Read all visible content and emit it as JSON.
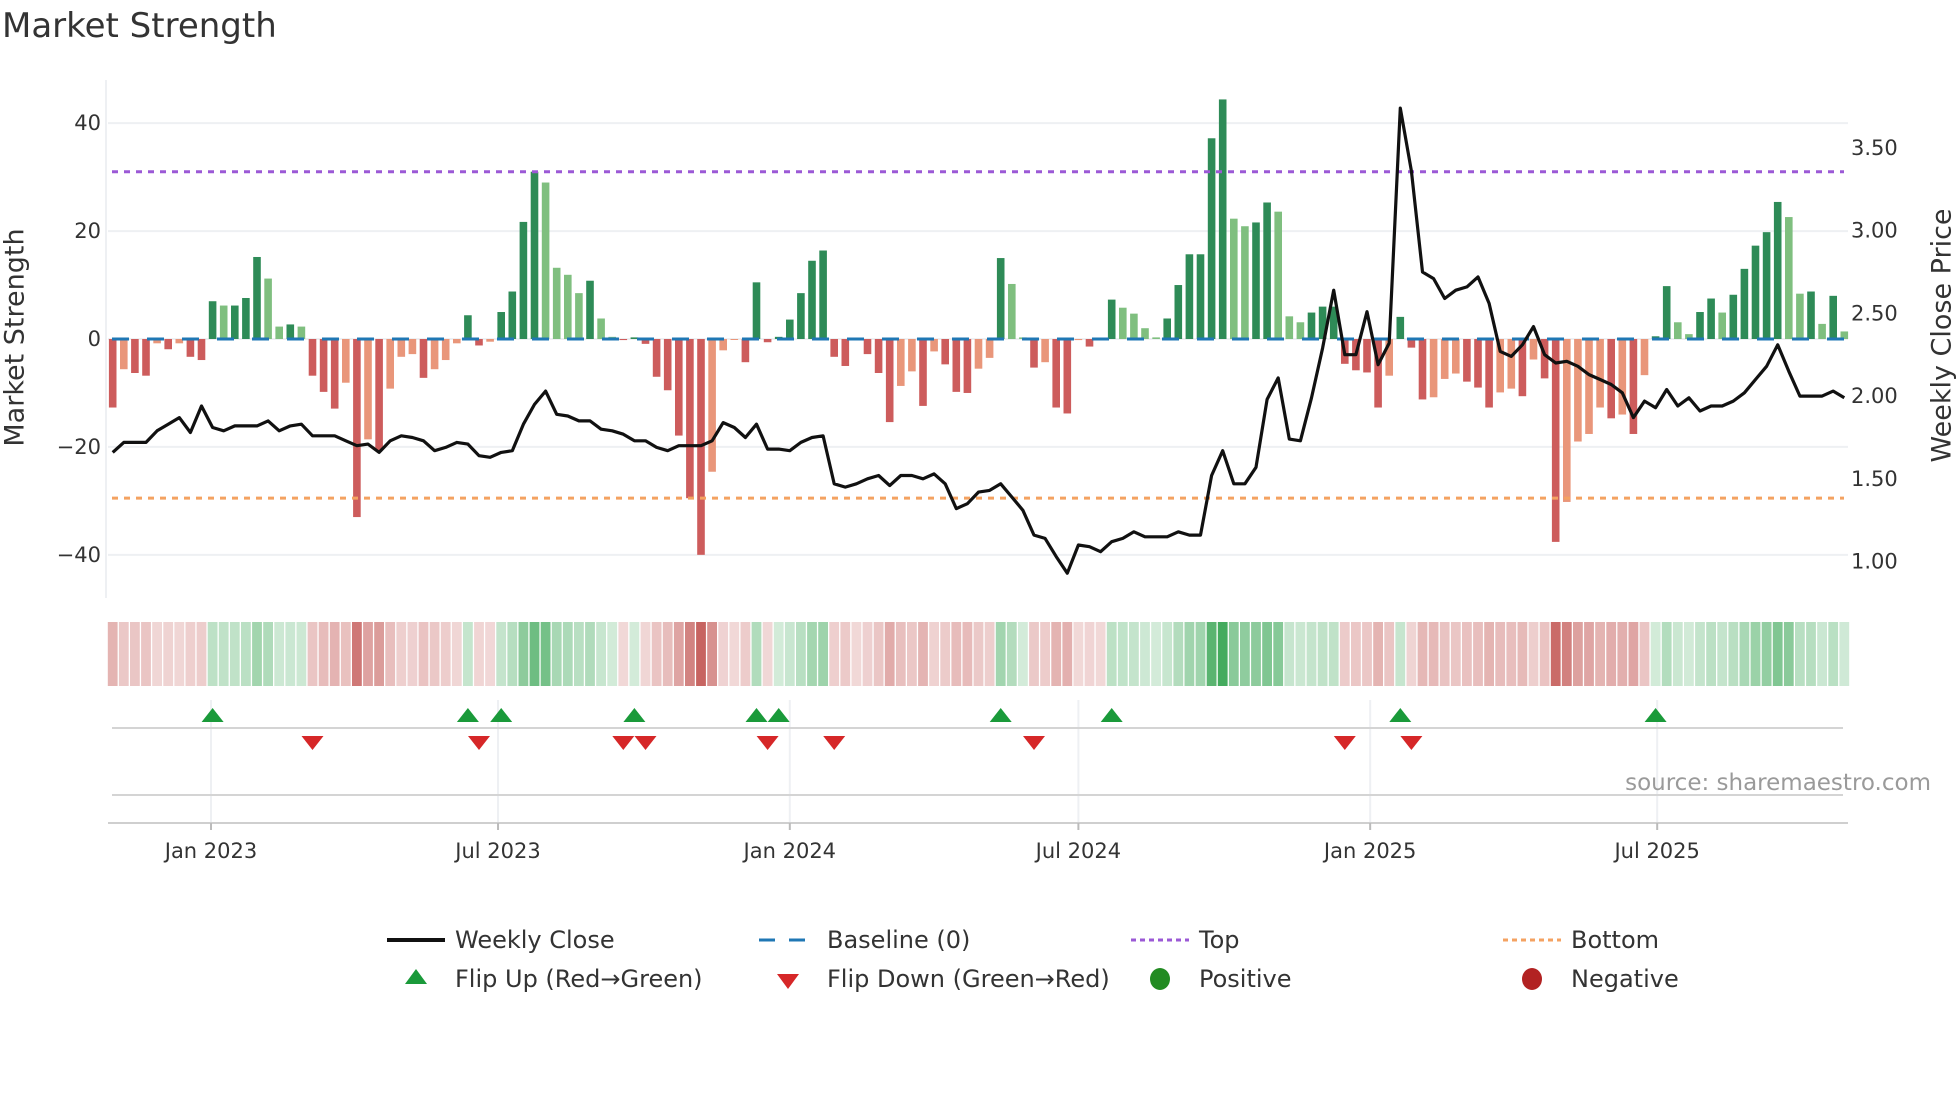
{
  "title": "Market Strength",
  "source": "source: sharemaestro.com",
  "colors": {
    "strong_green": "#2e8b57",
    "weak_green": "#7fbf7f",
    "strong_red": "#cd5c5c",
    "weak_red": "#e9967a",
    "baseline": "#1f77b4",
    "top": "#9b59d6",
    "bottom": "#f4a261",
    "price": "#111111",
    "flip_up": "#1a9a3a",
    "flip_down": "#d62728",
    "positive": "#228b22",
    "negative": "#b22222"
  },
  "legend": [
    {
      "key": "weekly_close",
      "label": "Weekly Close"
    },
    {
      "key": "baseline",
      "label": "Baseline (0)"
    },
    {
      "key": "top",
      "label": "Top"
    },
    {
      "key": "bottom",
      "label": "Bottom"
    },
    {
      "key": "flip_up",
      "label": "Flip Up (Red→Green)"
    },
    {
      "key": "flip_down",
      "label": "Flip Down (Green→Red)"
    },
    {
      "key": "positive",
      "label": "Positive"
    },
    {
      "key": "negative",
      "label": "Negative"
    }
  ],
  "chart_data": {
    "type": "bar",
    "title": "Market Strength",
    "ylabel": "Market Strength",
    "y2label": "Weekly Close Price",
    "start_date": "2022-10-31",
    "frequency": "weekly",
    "ylim": [
      -48,
      48
    ],
    "y2lim": [
      0.78,
      3.91
    ],
    "yticks": [
      40,
      20,
      0,
      -20,
      -40
    ],
    "ytick_labels": [
      "40",
      "20",
      "0",
      "−20",
      "−40"
    ],
    "y2ticks": [
      3.5,
      3.0,
      2.5,
      2.0,
      1.5,
      1.0
    ],
    "y2tick_labels": [
      "3.50",
      "3.00",
      "2.50",
      "2.00",
      "1.50",
      "1.00"
    ],
    "xticks": [
      "2023-01-01",
      "2023-07-01",
      "2024-01-01",
      "2024-07-01",
      "2025-01-01",
      "2025-07-01"
    ],
    "xtick_labels": [
      "Jan 2023",
      "Jul 2023",
      "Jan 2024",
      "Jul 2024",
      "Jan 2025",
      "Jul 2025"
    ],
    "top_level": 31,
    "bottom_level": -29.5,
    "baseline": 0,
    "grid": true,
    "legend_position": "bottom",
    "strength": [
      -12.7,
      -5.6,
      -6.3,
      -6.8,
      -0.8,
      -1.9,
      -0.8,
      -3.3,
      -3.9,
      7,
      6.2,
      6.2,
      7.6,
      15.2,
      11.2,
      2.3,
      2.7,
      2.3,
      -6.8,
      -9.8,
      -12.9,
      -8.1,
      -33,
      -18.6,
      -20.6,
      -9.2,
      -3.3,
      -2.8,
      -7.2,
      -5.6,
      -3.9,
      -0.8,
      4.4,
      -1.2,
      -0.5,
      5,
      8.8,
      21.7,
      31,
      29,
      13.2,
      11.9,
      8.5,
      10.8,
      3.8,
      0.4,
      -0.2,
      0.3,
      -0.9,
      -7,
      -9.5,
      -17.9,
      -29.5,
      -40,
      -24.6,
      -2.1,
      -0.1,
      -4.3,
      10.5,
      -0.6,
      0.4,
      3.6,
      8.5,
      14.5,
      16.4,
      -3.3,
      -5,
      -0.2,
      -2.8,
      -6.3,
      -15.4,
      -8.7,
      -6,
      -12.4,
      -2.3,
      -4.7,
      -9.8,
      -10,
      -5.5,
      -3.5,
      15,
      10.2,
      0.3,
      -5.3,
      -4.3,
      -12.7,
      -13.8,
      -0.2,
      -1.4,
      -0.2,
      7.3,
      5.8,
      4.7,
      2,
      0.3,
      3.8,
      10,
      15.7,
      15.7,
      37.2,
      44.4,
      22.3,
      20.9,
      21.6,
      25.3,
      23.6,
      4.2,
      3.1,
      4.9,
      6,
      6,
      -4.6,
      -5.8,
      -6.2,
      -12.7,
      -6.8,
      4.1,
      -1.6,
      -11.2,
      -10.8,
      -7.4,
      -6.4,
      -7.9,
      -9,
      -12.7,
      -9.9,
      -9.2,
      -10.6,
      -3.8,
      -7.3,
      -37.6,
      -30.2,
      -19,
      -17.6,
      -12.7,
      -14.7,
      -14,
      -17.6,
      -6.7,
      0.5,
      9.8,
      3.1,
      0.9,
      5,
      7.5,
      4.9,
      8.2,
      13,
      17.3,
      19.8,
      25.4,
      22.6,
      8.4,
      8.8,
      2.8,
      8,
      1.4
    ],
    "weekly_close": [
      1.66,
      1.72,
      1.72,
      1.72,
      1.79,
      1.83,
      1.87,
      1.78,
      1.94,
      1.81,
      1.79,
      1.82,
      1.82,
      1.82,
      1.85,
      1.79,
      1.82,
      1.83,
      1.76,
      1.76,
      1.76,
      1.73,
      1.7,
      1.71,
      1.66,
      1.73,
      1.76,
      1.75,
      1.73,
      1.67,
      1.69,
      1.72,
      1.71,
      1.64,
      1.63,
      1.66,
      1.67,
      1.83,
      1.95,
      2.03,
      1.89,
      1.88,
      1.85,
      1.85,
      1.8,
      1.79,
      1.77,
      1.73,
      1.73,
      1.69,
      1.67,
      1.7,
      1.7,
      1.7,
      1.73,
      1.84,
      1.81,
      1.75,
      1.83,
      1.68,
      1.68,
      1.67,
      1.72,
      1.75,
      1.76,
      1.47,
      1.45,
      1.47,
      1.5,
      1.52,
      1.46,
      1.52,
      1.52,
      1.5,
      1.53,
      1.47,
      1.32,
      1.35,
      1.42,
      1.43,
      1.47,
      1.39,
      1.31,
      1.16,
      1.14,
      1.03,
      0.93,
      1.1,
      1.09,
      1.06,
      1.12,
      1.14,
      1.18,
      1.15,
      1.15,
      1.15,
      1.18,
      1.16,
      1.16,
      1.52,
      1.67,
      1.47,
      1.47,
      1.57,
      1.98,
      2.11,
      1.74,
      1.73,
      1.99,
      2.29,
      2.64,
      2.25,
      2.25,
      2.51,
      2.19,
      2.32,
      3.74,
      3.36,
      2.75,
      2.71,
      2.59,
      2.64,
      2.66,
      2.72,
      2.56,
      2.27,
      2.24,
      2.31,
      2.42,
      2.25,
      2.2,
      2.21,
      2.18,
      2.13,
      2.1,
      2.07,
      2.02,
      1.87,
      1.97,
      1.93,
      2.04,
      1.94,
      1.99,
      1.91,
      1.94,
      1.94,
      1.97,
      2.02,
      2.1,
      2.18,
      2.31,
      2.15,
      2.0,
      2.0,
      2.0,
      2.03,
      1.99
    ],
    "flip_up_weeks": [
      9,
      32,
      35,
      47,
      58,
      60,
      80,
      90,
      116,
      139
    ],
    "flip_down_weeks": [
      18,
      33,
      46,
      48,
      59,
      65,
      83,
      111,
      117
    ]
  }
}
